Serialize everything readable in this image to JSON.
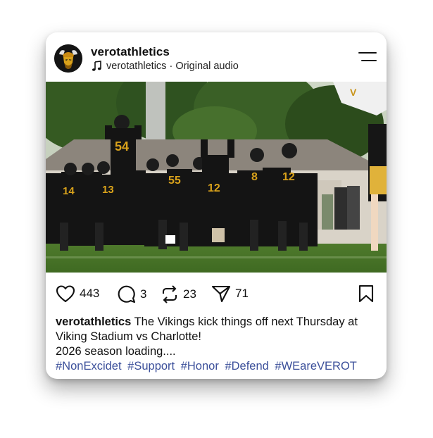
{
  "post": {
    "username": "verotathletics",
    "audio_artist": "verotathletics",
    "audio_separator": " · ",
    "audio_title": "Original audio",
    "likes": "443",
    "comments": "3",
    "reposts": "23",
    "shares": "71",
    "caption_user": "verotathletics",
    "caption_text": " The Vikings kick things off next Thursday at Viking Stadium vs Charlotte!",
    "caption_line2": "2026 season loading....",
    "hashtags": [
      "#NonExcidet",
      "#Support",
      "#Honor",
      "#Defend",
      "#WEareVEROT"
    ],
    "jersey_numbers": [
      "54",
      "14",
      "13",
      "55",
      "12",
      "8",
      "12"
    ]
  },
  "colors": {
    "hashtag": "#3b4f9a",
    "jersey_gold": "#d9a21b",
    "jersey_black": "#141414"
  },
  "icons": {
    "menu": "menu-icon",
    "audio": "music-note-icon",
    "like": "heart-icon",
    "comment": "comment-icon",
    "repost": "repost-icon",
    "share": "send-icon",
    "save": "bookmark-icon",
    "mute": "muted-speaker-icon"
  }
}
